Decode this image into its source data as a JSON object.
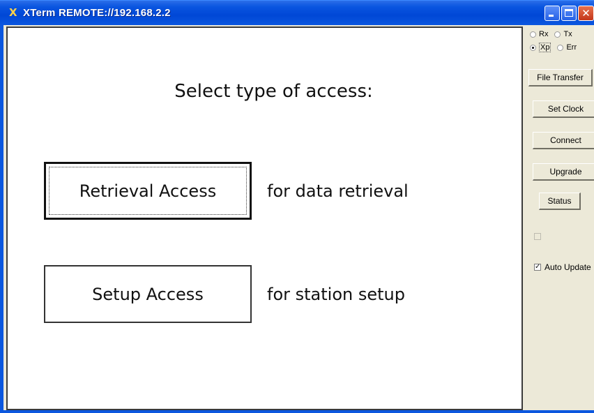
{
  "window": {
    "title": "XTerm REMOTE://192.168.2.2",
    "icon": "x-app-icon",
    "minimize_glyph": "",
    "close_glyph": "✕"
  },
  "terminal": {
    "prompt": "Select type of access:",
    "options": [
      {
        "button_label": "Retrieval Access",
        "description": "for data retrieval",
        "focused": true
      },
      {
        "button_label": "Setup Access",
        "description": "for station setup",
        "focused": false
      }
    ]
  },
  "panel": {
    "radios": [
      {
        "label": "Rx",
        "checked": false
      },
      {
        "label": "Tx",
        "checked": false
      },
      {
        "label": "Xp",
        "checked": true
      },
      {
        "label": "Err",
        "checked": false
      }
    ],
    "buttons": {
      "file_transfer": "File Transfer",
      "set_clock": "Set Clock",
      "connect": "Connect",
      "upgrade": "Upgrade",
      "status": "Status"
    },
    "checkboxes": [
      {
        "label": "",
        "checked": false,
        "disabled": true
      },
      {
        "label": "Auto Update",
        "checked": true,
        "disabled": false
      }
    ]
  }
}
